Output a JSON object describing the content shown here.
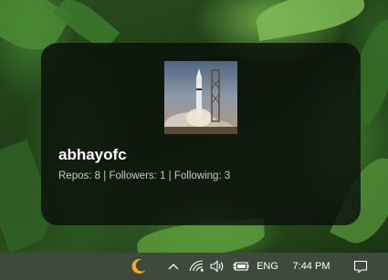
{
  "profile": {
    "username": "abhayofc",
    "repos_label": "Repos:",
    "repos": "8",
    "followers_label": "Followers:",
    "followers": "1",
    "following_label": "Following:",
    "following": "3",
    "separator": "|",
    "avatar_icon": "rocket-launch-image"
  },
  "taskbar": {
    "language": "ENG",
    "time": "7:44 PM",
    "icons": [
      "moon-icon",
      "chevron-up-icon",
      "wifi-icon",
      "volume-icon",
      "battery-icon",
      "notification-icon"
    ]
  },
  "colors": {
    "card_background": "#0a0e0a",
    "username": "#ffffff",
    "stats": "#c9c9c9",
    "moon": "#f5a623",
    "taskbar": "#3d4a3c"
  }
}
